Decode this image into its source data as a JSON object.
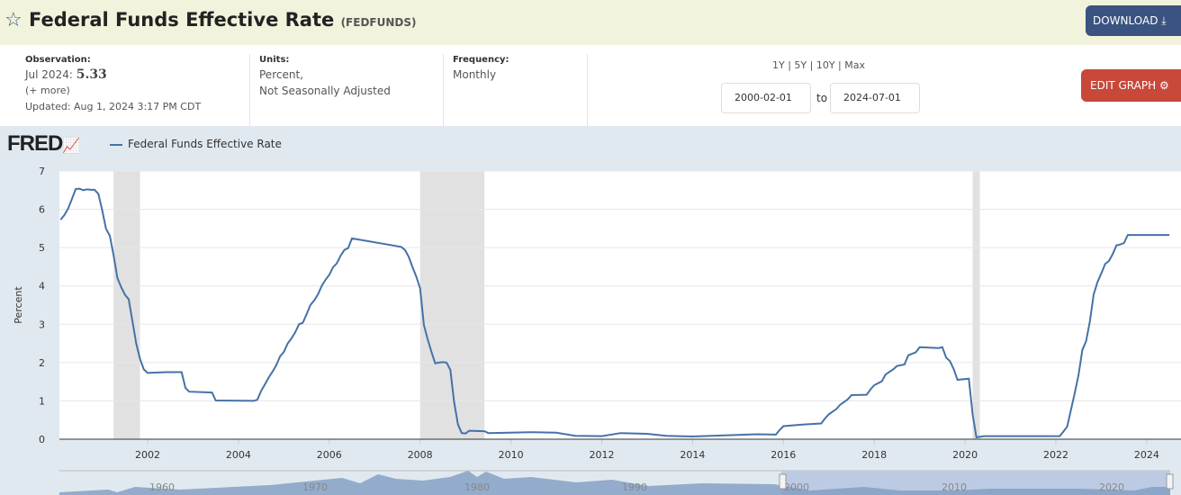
{
  "header": {
    "title": "Federal Funds Effective Rate",
    "series_id": "(FEDFUNDS)",
    "download_label": "DOWNLOAD",
    "star_icon": "star-icon"
  },
  "info": {
    "observation_label": "Observation:",
    "observation_date": "Jul 2024:",
    "observation_value": "5.33",
    "more_link": "(+ more)",
    "updated": "Updated: Aug 1, 2024 3:17 PM CDT",
    "units_label": "Units:",
    "units_line1": "Percent,",
    "units_line2": "Not Seasonally Adjusted",
    "frequency_label": "Frequency:",
    "frequency_value": "Monthly"
  },
  "range": {
    "presets": [
      "1Y",
      "5Y",
      "10Y",
      "Max"
    ],
    "start": "2000-02-01",
    "to_label": "to",
    "end": "2024-07-01",
    "edit_label": "EDIT GRAPH"
  },
  "colors": {
    "line": "#4572a7",
    "recession": "#e1e1e1",
    "accent_dark": "#3b5380",
    "accent_red": "#c8483a"
  },
  "chart_data": {
    "type": "line",
    "title": "Federal Funds Effective Rate",
    "legend": "Federal Funds Effective Rate",
    "logo": "FRED",
    "xlabel": "",
    "ylabel": "Percent",
    "ylim": [
      0,
      7
    ],
    "yticks": [
      "0",
      "1",
      "2",
      "3",
      "4",
      "5",
      "6",
      "7"
    ],
    "xticks": [
      "2002",
      "2004",
      "2006",
      "2008",
      "2010",
      "2012",
      "2014",
      "2016",
      "2018",
      "2020",
      "2022",
      "2024"
    ],
    "recessions": [
      [
        "2001-04",
        "2001-11"
      ],
      [
        "2008-01",
        "2009-06"
      ],
      [
        "2020-03",
        "2020-04"
      ]
    ],
    "series": [
      {
        "name": "Federal Funds Effective Rate",
        "points": [
          [
            "2000-02",
            5.73
          ],
          [
            "2000-03",
            5.85
          ],
          [
            "2000-04",
            6.02
          ],
          [
            "2000-05",
            6.27
          ],
          [
            "2000-06",
            6.53
          ],
          [
            "2000-07",
            6.54
          ],
          [
            "2000-08",
            6.5
          ],
          [
            "2000-09",
            6.52
          ],
          [
            "2000-10",
            6.51
          ],
          [
            "2000-11",
            6.51
          ],
          [
            "2000-12",
            6.4
          ],
          [
            "2001-01",
            5.98
          ],
          [
            "2001-02",
            5.49
          ],
          [
            "2001-03",
            5.31
          ],
          [
            "2001-04",
            4.8
          ],
          [
            "2001-05",
            4.21
          ],
          [
            "2001-06",
            3.97
          ],
          [
            "2001-07",
            3.77
          ],
          [
            "2001-08",
            3.65
          ],
          [
            "2001-09",
            3.07
          ],
          [
            "2001-10",
            2.49
          ],
          [
            "2001-11",
            2.09
          ],
          [
            "2001-12",
            1.82
          ],
          [
            "2002-01",
            1.73
          ],
          [
            "2002-06",
            1.75
          ],
          [
            "2002-10",
            1.75
          ],
          [
            "2002-11",
            1.34
          ],
          [
            "2002-12",
            1.24
          ],
          [
            "2003-06",
            1.22
          ],
          [
            "2003-07",
            1.01
          ],
          [
            "2004-05",
            1.0
          ],
          [
            "2004-06",
            1.03
          ],
          [
            "2004-07",
            1.26
          ],
          [
            "2004-08",
            1.43
          ],
          [
            "2004-09",
            1.61
          ],
          [
            "2004-10",
            1.76
          ],
          [
            "2004-11",
            1.93
          ],
          [
            "2004-12",
            2.16
          ],
          [
            "2005-01",
            2.28
          ],
          [
            "2005-02",
            2.5
          ],
          [
            "2005-03",
            2.63
          ],
          [
            "2005-04",
            2.79
          ],
          [
            "2005-05",
            3.0
          ],
          [
            "2005-06",
            3.04
          ],
          [
            "2005-07",
            3.26
          ],
          [
            "2005-08",
            3.5
          ],
          [
            "2005-09",
            3.62
          ],
          [
            "2005-10",
            3.78
          ],
          [
            "2005-11",
            4.0
          ],
          [
            "2005-12",
            4.16
          ],
          [
            "2006-01",
            4.29
          ],
          [
            "2006-02",
            4.49
          ],
          [
            "2006-03",
            4.59
          ],
          [
            "2006-04",
            4.79
          ],
          [
            "2006-05",
            4.94
          ],
          [
            "2006-06",
            4.99
          ],
          [
            "2006-07",
            5.24
          ],
          [
            "2007-08",
            5.02
          ],
          [
            "2007-09",
            4.94
          ],
          [
            "2007-10",
            4.76
          ],
          [
            "2007-11",
            4.49
          ],
          [
            "2007-12",
            4.24
          ],
          [
            "2008-01",
            3.94
          ],
          [
            "2008-02",
            2.98
          ],
          [
            "2008-03",
            2.61
          ],
          [
            "2008-04",
            2.28
          ],
          [
            "2008-05",
            1.98
          ],
          [
            "2008-06",
            2.0
          ],
          [
            "2008-07",
            2.01
          ],
          [
            "2008-08",
            2.0
          ],
          [
            "2008-09",
            1.81
          ],
          [
            "2008-10",
            0.97
          ],
          [
            "2008-11",
            0.39
          ],
          [
            "2008-12",
            0.16
          ],
          [
            "2009-01",
            0.15
          ],
          [
            "2009-02",
            0.22
          ],
          [
            "2009-06",
            0.21
          ],
          [
            "2009-07",
            0.16
          ],
          [
            "2010-06",
            0.18
          ],
          [
            "2010-07",
            0.18
          ],
          [
            "2011-01",
            0.17
          ],
          [
            "2011-06",
            0.09
          ],
          [
            "2012-01",
            0.08
          ],
          [
            "2012-06",
            0.16
          ],
          [
            "2013-01",
            0.14
          ],
          [
            "2013-06",
            0.09
          ],
          [
            "2014-01",
            0.07
          ],
          [
            "2015-06",
            0.13
          ],
          [
            "2015-11",
            0.12
          ],
          [
            "2015-12",
            0.24
          ],
          [
            "2016-01",
            0.34
          ],
          [
            "2016-06",
            0.38
          ],
          [
            "2016-11",
            0.41
          ],
          [
            "2016-12",
            0.54
          ],
          [
            "2017-01",
            0.65
          ],
          [
            "2017-03",
            0.79
          ],
          [
            "2017-04",
            0.9
          ],
          [
            "2017-06",
            1.04
          ],
          [
            "2017-07",
            1.15
          ],
          [
            "2017-11",
            1.16
          ],
          [
            "2017-12",
            1.3
          ],
          [
            "2018-01",
            1.41
          ],
          [
            "2018-03",
            1.51
          ],
          [
            "2018-04",
            1.69
          ],
          [
            "2018-06",
            1.82
          ],
          [
            "2018-07",
            1.91
          ],
          [
            "2018-09",
            1.95
          ],
          [
            "2018-10",
            2.19
          ],
          [
            "2018-12",
            2.27
          ],
          [
            "2019-01",
            2.4
          ],
          [
            "2019-06",
            2.38
          ],
          [
            "2019-07",
            2.4
          ],
          [
            "2019-08",
            2.13
          ],
          [
            "2019-09",
            2.04
          ],
          [
            "2019-10",
            1.83
          ],
          [
            "2019-11",
            1.55
          ],
          [
            "2020-02",
            1.58
          ],
          [
            "2020-03",
            0.65
          ],
          [
            "2020-04",
            0.05
          ],
          [
            "2020-06",
            0.08
          ],
          [
            "2021-06",
            0.08
          ],
          [
            "2022-02",
            0.08
          ],
          [
            "2022-03",
            0.2
          ],
          [
            "2022-04",
            0.33
          ],
          [
            "2022-05",
            0.77
          ],
          [
            "2022-06",
            1.21
          ],
          [
            "2022-07",
            1.68
          ],
          [
            "2022-08",
            2.33
          ],
          [
            "2022-09",
            2.56
          ],
          [
            "2022-10",
            3.08
          ],
          [
            "2022-11",
            3.78
          ],
          [
            "2022-12",
            4.1
          ],
          [
            "2023-01",
            4.33
          ],
          [
            "2023-02",
            4.57
          ],
          [
            "2023-03",
            4.65
          ],
          [
            "2023-04",
            4.83
          ],
          [
            "2023-05",
            5.06
          ],
          [
            "2023-06",
            5.08
          ],
          [
            "2023-07",
            5.12
          ],
          [
            "2023-08",
            5.33
          ],
          [
            "2024-07",
            5.33
          ]
        ]
      }
    ],
    "navigator_ticks": [
      "1960",
      "1970",
      "1980",
      "1990",
      "2000",
      "2010",
      "2020"
    ]
  }
}
